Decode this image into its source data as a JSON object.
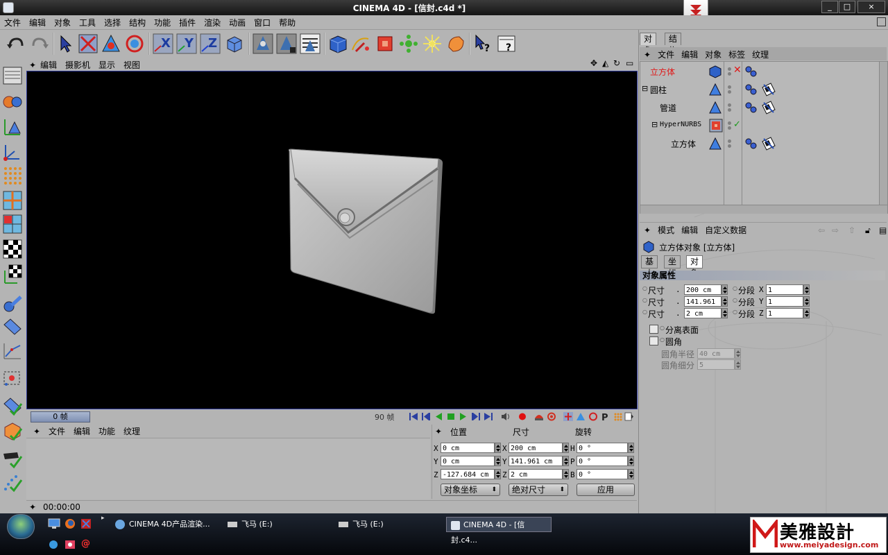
{
  "window": {
    "title": "CINEMA 4D - [信封.c4d *]",
    "buttons": [
      "_",
      "□",
      "×"
    ]
  },
  "menubar": [
    "文件",
    "编辑",
    "对象",
    "工具",
    "选择",
    "结构",
    "功能",
    "插件",
    "渲染",
    "动画",
    "窗口",
    "帮助"
  ],
  "viewport": {
    "menu": [
      "编辑",
      "摄影机",
      "显示",
      "视图"
    ]
  },
  "timeline": {
    "current_frame": "0 帧",
    "end_frame": "90 帧"
  },
  "material_manager": {
    "menu": [
      "文件",
      "编辑",
      "功能",
      "纹理"
    ]
  },
  "status": {
    "time": "00:00:00"
  },
  "coord_manager": {
    "headers": [
      "位置",
      "尺寸",
      "旋转"
    ],
    "pos": [
      {
        "axis": "X",
        "value": "0 cm"
      },
      {
        "axis": "Y",
        "value": "0 cm"
      },
      {
        "axis": "Z",
        "value": "-127.684 cm"
      }
    ],
    "size": [
      {
        "axis": "X",
        "value": "200 cm"
      },
      {
        "axis": "Y",
        "value": "141.961 cm"
      },
      {
        "axis": "Z",
        "value": "2 cm"
      }
    ],
    "rot": [
      {
        "axis": "H",
        "value": "0 °"
      },
      {
        "axis": "P",
        "value": "0 °"
      },
      {
        "axis": "B",
        "value": "0 °"
      }
    ],
    "mode_select": "对象坐标",
    "size_select": "绝对尺寸",
    "apply_button": "应用"
  },
  "object_manager": {
    "tabs": [
      "对象",
      "结构"
    ],
    "menu": [
      "文件",
      "编辑",
      "对象",
      "标签",
      "纹理"
    ],
    "objects": [
      {
        "name": "立方体",
        "selected": true
      },
      {
        "name": "圆柱",
        "expander": "⊟"
      },
      {
        "name": "管道"
      },
      {
        "name": "HyperNURBS",
        "expander": "⊟"
      },
      {
        "name": "立方体"
      }
    ]
  },
  "attribute_manager": {
    "menu": [
      "模式",
      "编辑",
      "自定义数据"
    ],
    "object_title": "立方体对象 [立方体]",
    "tabs": [
      "基本",
      "坐标",
      "对象"
    ],
    "section_title": "对象属性",
    "size_label": "尺寸",
    "seg_label": "分段",
    "size_x": "200 cm",
    "size_y": "141.961",
    "size_z": "2 cm",
    "seg_x": "1",
    "seg_y": "1",
    "seg_z": "1",
    "separate_surfaces": "分离表面",
    "fillet": "圆角",
    "fillet_radius_label": "圆角半径",
    "fillet_radius": "40 cm",
    "fillet_sub_label": "圆角细分",
    "fillet_sub": "5"
  },
  "taskbar": {
    "items": [
      "CINEMA 4D产品渲染...",
      "飞马 (E:)",
      "飞马 (E:)",
      "CINEMA 4D - [信封.c4..."
    ],
    "logo_text": "美雅設計",
    "logo_url": "www.meiyadesign.com"
  }
}
